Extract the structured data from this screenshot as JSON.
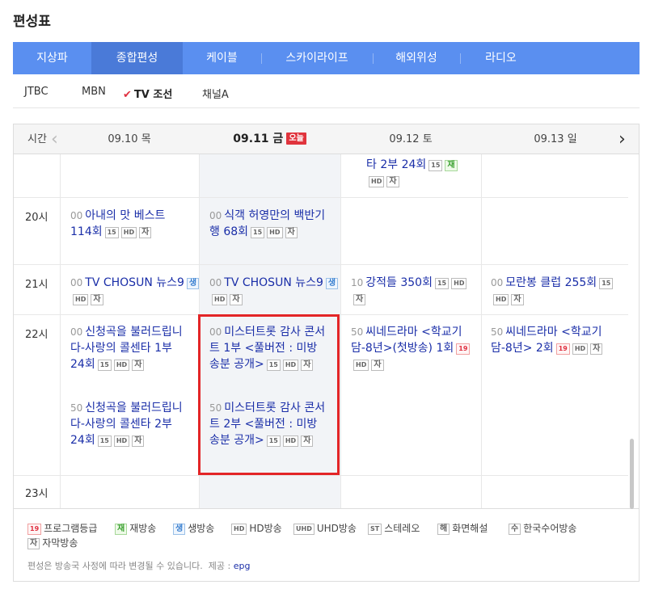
{
  "page_title": "편성표",
  "tabs": [
    {
      "label": "지상파"
    },
    {
      "label": "종합편성"
    },
    {
      "label": "케이블"
    },
    {
      "label": "스카이라이프"
    },
    {
      "label": "해외위성"
    },
    {
      "label": "라디오"
    }
  ],
  "active_tab": "종합편성",
  "channels": [
    {
      "label": "JTBC"
    },
    {
      "label": "MBN"
    },
    {
      "label": "TV 조선"
    },
    {
      "label": "채널A"
    }
  ],
  "active_channel": "TV 조선",
  "schedule": {
    "time_header": "시간",
    "prev_icon": "chevron-left-icon",
    "next_icon": "chevron-right-icon",
    "days": [
      {
        "date": "09.10 목"
      },
      {
        "date": "09.11 금"
      },
      {
        "date": "09.12 토"
      },
      {
        "date": "09.13 일"
      }
    ],
    "today_badge": "오늘",
    "hours": [
      "20시",
      "21시",
      "22시",
      "23시"
    ],
    "programs": {
      "p_top_sat": {
        "title": "타 2부 24회",
        "badges": [
          "15",
          "재",
          "HD",
          "자"
        ]
      },
      "p20_thu": {
        "min": "00",
        "title": "아내의 맛 베스트 114회",
        "badges": [
          "15",
          "HD",
          "자"
        ]
      },
      "p20_fri": {
        "min": "00",
        "title": "식객 허영만의 백반기행 68회",
        "badges": [
          "15",
          "HD",
          "자"
        ]
      },
      "p21_thu": {
        "min": "00",
        "title": "TV CHOSUN 뉴스9",
        "badges": [
          "생",
          "HD",
          "자"
        ]
      },
      "p21_fri": {
        "min": "00",
        "title": "TV CHOSUN 뉴스9",
        "badges": [
          "생",
          "HD",
          "자"
        ]
      },
      "p21_sat": {
        "min": "10",
        "title": "강적들 350회",
        "badges": [
          "15",
          "HD",
          "자"
        ]
      },
      "p21_sun": {
        "min": "00",
        "title": "모란봉 클럽 255회",
        "badges": [
          "15",
          "HD",
          "자"
        ]
      },
      "p22_thu_a": {
        "min": "00",
        "title": "신청곡을 불러드립니다-사랑의 콜센타 1부 24회",
        "badges": [
          "15",
          "HD",
          "자"
        ]
      },
      "p22_thu_b": {
        "min": "50",
        "title": "신청곡을 불러드립니다-사랑의 콜센타 2부 24회",
        "badges": [
          "15",
          "HD",
          "자"
        ]
      },
      "p22_fri_a": {
        "min": "00",
        "title": "미스터트롯 감사 콘서트 1부 <풀버전 : 미방송분 공개>",
        "badges": [
          "15",
          "HD",
          "자"
        ]
      },
      "p22_fri_b": {
        "min": "50",
        "title": "미스터트롯 감사 콘서트 2부 <풀버전 : 미방송분 공개>",
        "badges": [
          "15",
          "HD",
          "자"
        ]
      },
      "p22_sat": {
        "min": "50",
        "title": "씨네드라마 <학교기담-8년>(첫방송) 1회",
        "badges": [
          "19",
          "HD",
          "자"
        ]
      },
      "p22_sun": {
        "min": "50",
        "title": "씨네드라마 <학교기담-8년> 2회",
        "badges": [
          "19",
          "HD",
          "자"
        ]
      }
    }
  },
  "legend": {
    "items": [
      {
        "badge": "19",
        "label": "프로그램등급"
      },
      {
        "badge": "재",
        "label": "재방송"
      },
      {
        "badge": "생",
        "label": "생방송"
      },
      {
        "badge": "HD",
        "label": "HD방송"
      },
      {
        "badge": "UHD",
        "label": "UHD방송"
      },
      {
        "badge": "ST",
        "label": "스테레오"
      },
      {
        "badge": "해",
        "label": "화면해설"
      },
      {
        "badge": "수",
        "label": "한국수어방송"
      },
      {
        "badge": "자",
        "label": "자막방송"
      }
    ],
    "note": "편성은 방송국 사정에 따라 변경될 수 있습니다.",
    "provider_label": "제공 :",
    "provider": "epg"
  },
  "colors": {
    "tab_bar": "#5a8ff0",
    "tab_active": "#4a7ad8",
    "program_title": "#1a2ea8",
    "highlight_box": "#e32527",
    "today_badge": "#e0343d",
    "check_mark": "#e03040"
  }
}
